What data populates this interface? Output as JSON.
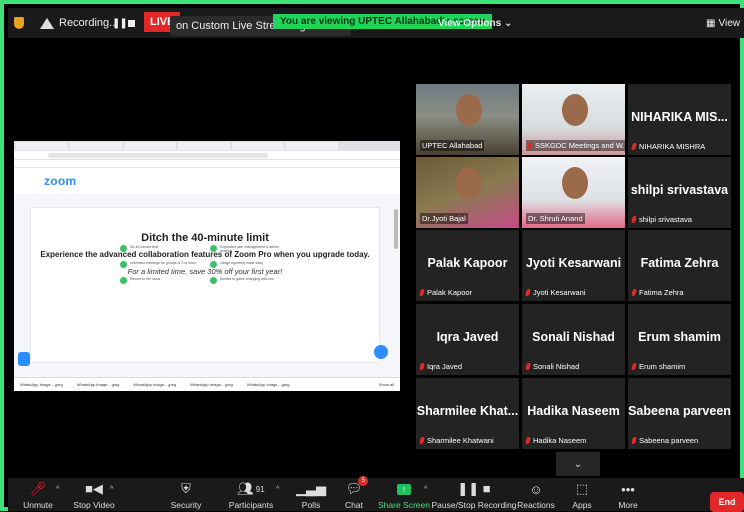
{
  "topbar": {
    "recording_label": "Recording...",
    "live_label": "LIVE",
    "streaming_label": "on Custom Live Streaming Service",
    "viewing_banner": "You are viewing UPTEC Allahabad's screen",
    "view_options_label": "View Options ⌄",
    "view_label": "View"
  },
  "shared_screen": {
    "logo": "zoom",
    "title": "Ditch the 40-minute limit",
    "subtitle": "Experience the advanced collaboration features of Zoom Pro when you upgrade today.",
    "offer": "For a limited time, save 30% off your first year!",
    "features": [
      "No 40-minute limit",
      "Expanded user management & admin controls",
      "Unlimited meetings for groups of 3 or more",
      "Usage reporting made easy",
      "Record to the cloud",
      "Access to game changing add-ons"
    ],
    "downloads": [
      "WhatsApp Image....jpeg",
      "WhatsApp Image....jpeg",
      "WhatsApp Image....jpeg",
      "WhatsApp Image....jpeg",
      "WhatsApp Image....jpeg"
    ],
    "show_all": "Show all"
  },
  "participants": [
    {
      "label": "UPTEC Allahabad",
      "big_name": "",
      "muted": false,
      "video": true
    },
    {
      "label": "SSKGDC Meetings and W...",
      "big_name": "",
      "muted": true,
      "video": true
    },
    {
      "label": "NIHARIKA MISHRA",
      "big_name": "NIHARIKA MIS...",
      "muted": true,
      "video": false
    },
    {
      "label": "Dr.Jyoti Bajal",
      "big_name": "",
      "muted": false,
      "video": true
    },
    {
      "label": "Dr. Shruti Anand",
      "big_name": "",
      "muted": false,
      "video": true
    },
    {
      "label": "shilpi srivastava",
      "big_name": "shilpi srivastava",
      "muted": true,
      "video": false
    },
    {
      "label": "Palak Kapoor",
      "big_name": "Palak Kapoor",
      "muted": true,
      "video": false
    },
    {
      "label": "Jyoti Kesarwani",
      "big_name": "Jyoti Kesarwani",
      "muted": true,
      "video": false
    },
    {
      "label": "Fatima Zehra",
      "big_name": "Fatima Zehra",
      "muted": true,
      "video": false
    },
    {
      "label": "Iqra Javed",
      "big_name": "Iqra Javed",
      "muted": true,
      "video": false
    },
    {
      "label": "Sonali Nishad",
      "big_name": "Sonali Nishad",
      "muted": true,
      "video": false
    },
    {
      "label": "Erum shamim",
      "big_name": "Erum shamim",
      "muted": true,
      "video": false
    },
    {
      "label": "Sharmilee Khatwani",
      "big_name": "Sharmilee Khat...",
      "muted": true,
      "video": false
    },
    {
      "label": "Hadika Naseem",
      "big_name": "Hadika Naseem",
      "muted": true,
      "video": false
    },
    {
      "label": "Sabeena parveen",
      "big_name": "Sabeena parveen",
      "muted": true,
      "video": false
    }
  ],
  "toolbar": {
    "unmute": "Unmute",
    "stop_video": "Stop Video",
    "security": "Security",
    "participants": "Participants",
    "participants_count": "91",
    "polls": "Polls",
    "chat": "Chat",
    "chat_badge": "5",
    "share_screen": "Share Screen",
    "pause_stop_recording": "Pause/Stop Recording",
    "reactions": "Reactions",
    "apps": "Apps",
    "more": "More",
    "end": "End"
  },
  "colors": {
    "frame": "#3fe07a",
    "live": "#e02828",
    "share_green": "#1ec25a",
    "active_speaker": "#f3e02a"
  }
}
